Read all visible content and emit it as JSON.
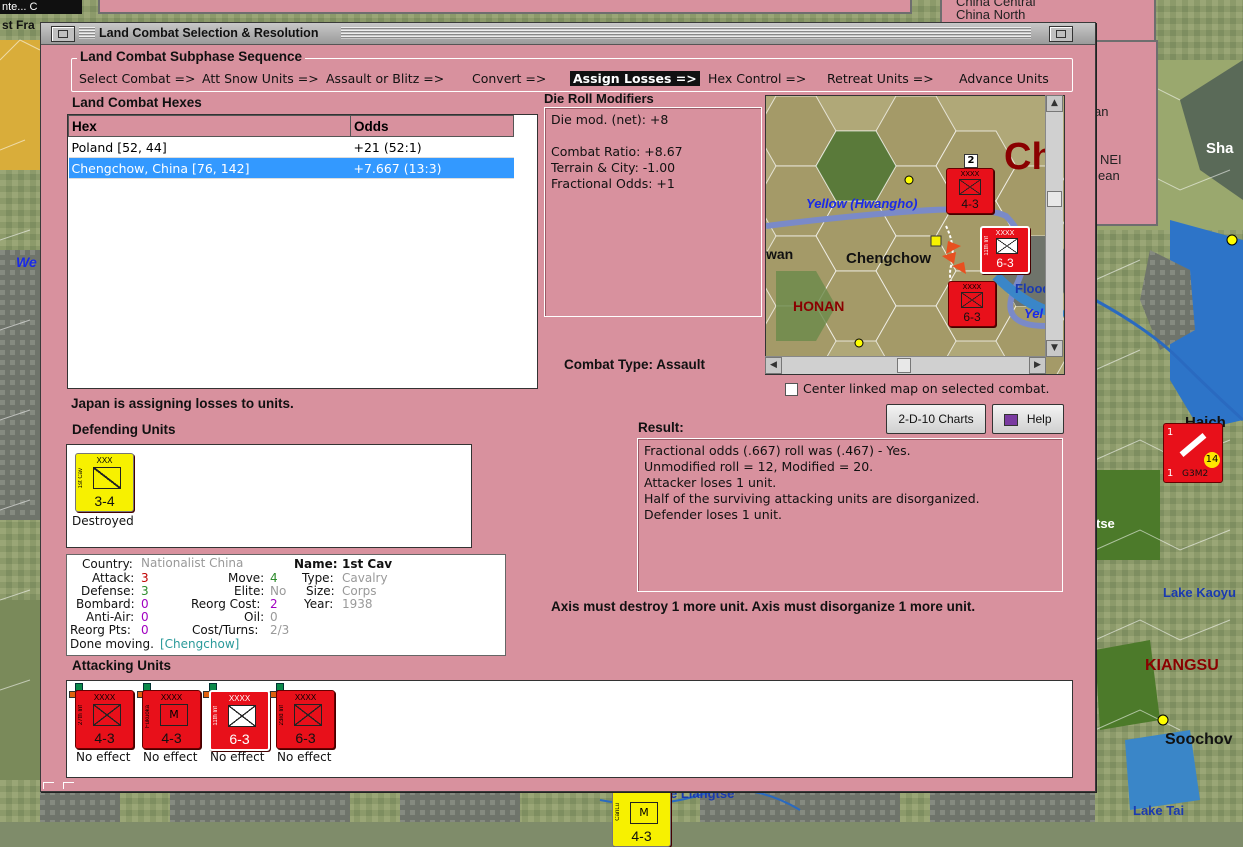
{
  "background": {
    "top_strip_text": "nte... C",
    "left_title_fragment": "st Fra",
    "right_window_lines": [
      "China Central",
      "China North"
    ],
    "right_window2_lines": [
      "an",
      "NEI",
      "ean"
    ],
    "map_labels": {
      "we": "We",
      "sha": "Sha",
      "haich": "Haich",
      "lake_kaoyu": "Lake Kaoyu",
      "kiangsu": "KIANGSU",
      "soochow": "Soochov",
      "lake_tai": "Lake Tai",
      "yangtse": "e Liangtse",
      "tse": "tse",
      "ch_big": "Ch"
    },
    "bg_counter": {
      "top": "1",
      "bottom_left": "1",
      "code": "G3M2",
      "value": "14"
    },
    "bottom_counter": {
      "letter": "M",
      "side": "CanLu",
      "str": "4-3"
    }
  },
  "dialog": {
    "title": "Land Combat Selection & Resolution",
    "subphase_title": "Land Combat Subphase Sequence",
    "steps": [
      "Select Combat =>",
      "Att Snow Units =>",
      "Assault or Blitz =>",
      "Convert =>",
      "Assign Losses =>",
      "Hex Control =>",
      "Retreat Units =>",
      "Advance Units"
    ],
    "hexes_label": "Land Combat Hexes",
    "hex_table": {
      "headers": [
        "Hex",
        "Odds"
      ],
      "rows": [
        {
          "hex": "Poland [52, 44]",
          "odds": "+21 (52:1)"
        },
        {
          "hex": "Chengchow, China [76, 142]",
          "odds": "+7.667 (13:3)"
        }
      ]
    },
    "die_label": "Die Roll Modifiers",
    "die_lines": [
      "Die mod. (net): +8",
      "Combat Ratio: +8.67",
      "Terrain & City: -1.00",
      "Fractional Odds: +1"
    ],
    "combat_type": "Combat Type:  Assault",
    "minimap": {
      "ch": "Ch",
      "river": "Yellow (Hwangho)",
      "chengchow": "Chengchow",
      "honan": "HONAN",
      "wan": "wan",
      "flood": "Flood",
      "yel": "Yel",
      "stack_count": "2",
      "units": [
        {
          "str": "4-3",
          "size": "XXXX"
        },
        {
          "str": "6-3",
          "size": "XXXX",
          "side": "11th Inf"
        },
        {
          "str": "6-3",
          "size": "XXXX"
        }
      ]
    },
    "center_linked": "Center linked map on selected combat.",
    "status": "Japan is assigning losses to units.",
    "buttons": {
      "charts": "2-D-10 Charts",
      "help": "Help"
    },
    "result_label": "Result:",
    "result_lines": [
      "Fractional odds (.667) roll was (.467)  - Yes.",
      "Unmodified roll = 12, Modified = 20.",
      "Attacker loses 1 unit.",
      "Half of the surviving attacking units are disorganized.",
      "Defender loses 1 unit."
    ],
    "axis_msg": "Axis must destroy 1 more unit. Axis must disorganize 1 more unit.",
    "defending_label": "Defending Units",
    "defender": {
      "size": "XXX",
      "side": "1st Cav",
      "str": "3-4",
      "status": "Destroyed"
    },
    "info": {
      "country_lbl": "Country:",
      "country": "Nationalist China",
      "attack_lbl": "Attack:",
      "attack": "3",
      "defense_lbl": "Defense:",
      "defense": "3",
      "bombard_lbl": "Bombard:",
      "bombard": "0",
      "antiair_lbl": "Anti-Air:",
      "antiair": "0",
      "reorg_lbl": "Reorg Pts:",
      "reorg": "0",
      "move_lbl": "Move:",
      "move": "4",
      "elite_lbl": "Elite:",
      "elite": "No",
      "reorgcost_lbl": "Reorg Cost:",
      "reorgcost": "2",
      "oil_lbl": "Oil:",
      "oil": "0",
      "cost_lbl": "Cost/Turns:",
      "cost": "2/3",
      "name_lbl": "Name:",
      "name": "1st Cav",
      "type_lbl": "Type:",
      "type": "Cavalry",
      "sz_lbl": "Size:",
      "sz": "Corps",
      "year_lbl": "Year:",
      "year": "1938",
      "done_lbl": "Done moving.",
      "done": "[Chengchow]"
    },
    "attacking_label": "Attacking Units",
    "attackers": [
      {
        "size": "XXXX",
        "side": "27th Inf",
        "str": "4-3",
        "status": "No effect",
        "letter": ""
      },
      {
        "size": "XXXX",
        "side": "Fukuoka",
        "str": "4-3",
        "status": "No effect",
        "letter": "M"
      },
      {
        "size": "XXXX",
        "side": "11th Inf",
        "str": "6-3",
        "status": "No effect",
        "letter": ""
      },
      {
        "size": "XXXX",
        "side": "23rd Inf",
        "str": "6-3",
        "status": "No effect",
        "letter": ""
      }
    ]
  },
  "colors": {
    "dialog_bg": "#d8919e",
    "selection": "#3399ff",
    "unit_red": "#e8101a",
    "unit_yellow": "#f7f100"
  }
}
